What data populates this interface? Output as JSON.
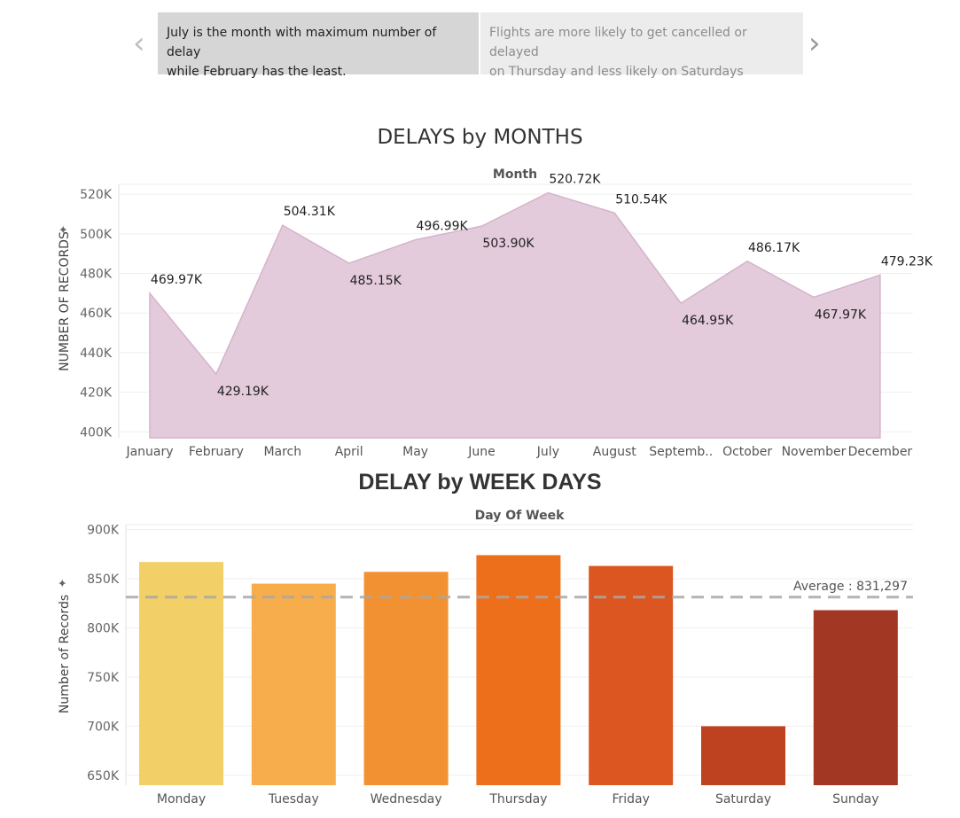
{
  "story": {
    "points": [
      {
        "text_line1": "July is the month with maximum number of delay",
        "text_line2": "while February has the least."
      },
      {
        "text_line1": "Flights are more likely to get cancelled or delayed",
        "text_line2": "on Thursday and less likely on Saturdays"
      }
    ],
    "prev_icon": "chevron-left-icon",
    "next_icon": "chevron-right-icon"
  },
  "colors": {
    "area_fill": "#e3cbdc",
    "area_stroke": "#d4b3ca",
    "average_line": "#a8a8a8",
    "weekday_bars": [
      "#f2cf67",
      "#f7ad4c",
      "#f29132",
      "#ed6f1c",
      "#db5621",
      "#bf4220",
      "#a23723"
    ]
  },
  "chart_data": [
    {
      "type": "area",
      "title": "DELAYS by MONTHS",
      "column_header": "Month",
      "ylabel": "NUMBER OF RECORDS",
      "categories": [
        "January",
        "February",
        "March",
        "April",
        "May",
        "June",
        "July",
        "August",
        "Septemb..",
        "October",
        "November",
        "December"
      ],
      "values": [
        469970,
        429190,
        504310,
        485150,
        496990,
        503900,
        520720,
        510540,
        464950,
        486170,
        467970,
        479230
      ],
      "data_labels": [
        "469.97K",
        "429.19K",
        "504.31K",
        "485.15K",
        "496.99K",
        "503.90K",
        "520.72K",
        "510.54K",
        "464.95K",
        "486.17K",
        "467.97K",
        "479.23K"
      ],
      "label_side": [
        "above",
        "below",
        "above",
        "below",
        "above",
        "below",
        "above",
        "above",
        "below",
        "above",
        "below",
        "above"
      ],
      "yticks": [
        400000,
        420000,
        440000,
        460000,
        480000,
        500000,
        520000
      ],
      "ytick_labels": [
        "400K",
        "420K",
        "440K",
        "460K",
        "480K",
        "500K",
        "520K"
      ],
      "ylim": [
        397000,
        525000
      ],
      "grid": true,
      "legend": "none"
    },
    {
      "type": "bar",
      "title": "DELAY by WEEK DAYS",
      "column_header": "Day Of Week",
      "ylabel": "Number of Records",
      "categories": [
        "Monday",
        "Tuesday",
        "Wednesday",
        "Thursday",
        "Friday",
        "Saturday",
        "Sunday"
      ],
      "values": [
        867000,
        845000,
        857000,
        874000,
        863000,
        700000,
        818000
      ],
      "yticks": [
        650000,
        700000,
        750000,
        800000,
        850000,
        900000
      ],
      "ytick_labels": [
        "650K",
        "700K",
        "750K",
        "800K",
        "850K",
        "900K"
      ],
      "ylim": [
        640000,
        905000
      ],
      "reference_line": {
        "value": 831297,
        "label": "Average : 831,297"
      },
      "grid": true,
      "legend": "none"
    }
  ]
}
